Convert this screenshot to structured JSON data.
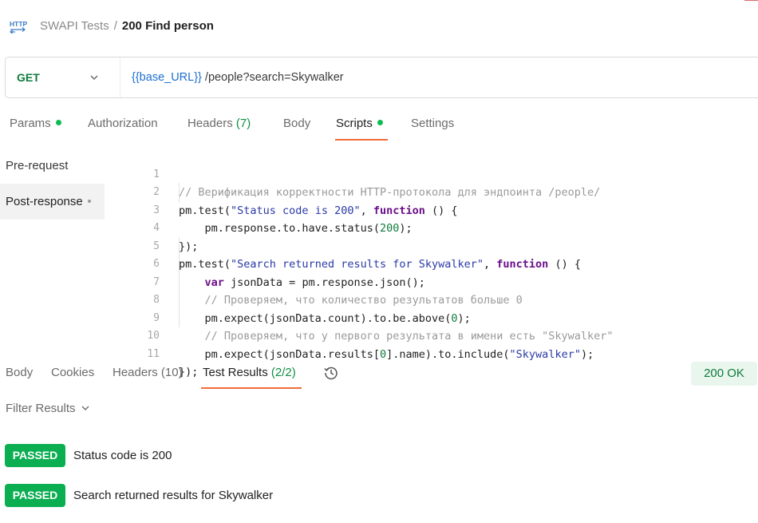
{
  "header": {
    "collection": "SWAPI Tests",
    "separator": "/",
    "request_name": "200 Find person",
    "icon": "http-icon"
  },
  "request": {
    "method": "GET",
    "url_variable": "{{base_URL}}",
    "url_path": " /people?search=Skywalker"
  },
  "request_tabs": {
    "params": "Params",
    "authorization": "Authorization",
    "headers": "Headers",
    "headers_count": "(7)",
    "body": "Body",
    "scripts": "Scripts",
    "settings": "Settings",
    "active": "Scripts"
  },
  "script_menu": {
    "pre_request": "Pre-request",
    "post_response": "Post-response"
  },
  "code": {
    "line_numbers": [
      "1",
      "2",
      "3",
      "4",
      "5",
      "6",
      "7",
      "8",
      "9",
      "10",
      "11"
    ],
    "l1_comment": "// Верификация корректности HTTP-протокола для эндпоинта /people/",
    "l2_a": "pm.test(",
    "l2_str": "\"Status code is 200\"",
    "l2_b": ", ",
    "l2_kw": "function",
    "l2_c": " () {",
    "l3_a": "    pm.response.to.have.status(",
    "l3_num": "200",
    "l3_b": ");",
    "l4": "});",
    "l5_a": "pm.test(",
    "l5_str": "\"Search returned results for Skywalker\"",
    "l5_b": ", ",
    "l5_kw": "function",
    "l5_c": " () {",
    "l6_kw": "    var",
    "l6_a": " jsonData = pm.response.json();",
    "l7_comment": "    // Проверяем, что количество результатов больше 0",
    "l8_a": "    pm.expect(jsonData.count).to.be.above(",
    "l8_num": "0",
    "l8_b": ");",
    "l9_comment": "    // Проверяем, что у первого результата в имени есть \"Skywalker\"",
    "l10_a": "    pm.expect(jsonData.results[",
    "l10_num": "0",
    "l10_b": "].name).to.include(",
    "l10_str": "\"Skywalker\"",
    "l10_c": ");",
    "l11": "});"
  },
  "response_tabs": {
    "body": "Body",
    "cookies": "Cookies",
    "headers": "Headers",
    "headers_count": "(10)",
    "test_results": "Test Results",
    "test_results_count": "(2/2)",
    "active": "Test Results",
    "history_icon": "history-icon"
  },
  "status": "200 OK",
  "filter_label": "Filter Results",
  "results": [
    {
      "status": "PASSED",
      "name": "Status code is 200"
    },
    {
      "status": "PASSED",
      "name": "Search returned results for Skywalker"
    }
  ],
  "colors": {
    "accent": "#f26b3a",
    "method_green": "#0f7b3c",
    "passed_badge": "#0cae52",
    "url_variable": "#1c6fd1",
    "dot_green": "#0cbb52"
  }
}
